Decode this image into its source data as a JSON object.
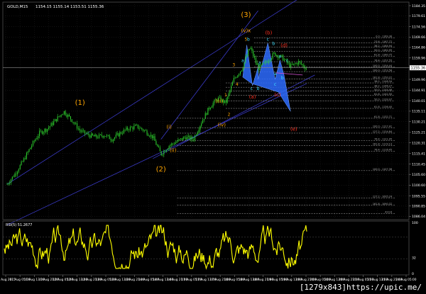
{
  "header": {
    "title": "GOLD,M15",
    "ohlc": "1154.15 1155.14 1153.51 1155.36",
    "indicator_label": "RSI(5) 51.2677"
  },
  "watermark": "[1279x843]https://upic.me/",
  "colors": {
    "background": "#000000",
    "grid": "#1c1c1c",
    "candles": "#2fd82f",
    "rsi": "#ffff00",
    "channel": "#3a3ac8",
    "abc_fill": "#2d6bff",
    "wave_orange": "#ffa500",
    "wave_red": "#ff3020",
    "fib": "#b0b0b0",
    "labels_text": "#ffffff"
  },
  "chart_data": [
    {
      "type": "candlestick",
      "title": "GOLD,M15",
      "y_axis_ticks": [
        1184.35,
        1179.61,
        1174.56,
        1169.66,
        1164.86,
        1159.96,
        1155.36,
        1149.96,
        1144.91,
        1140.01,
        1135.11,
        1130.21,
        1125.21,
        1120.31,
        1115.41,
        1110.45,
        1105.6,
        1100.6,
        1095.55,
        1090.85,
        1086.04
      ],
      "ylim": [
        1084.5,
        1186
      ],
      "x_axis_ticks": [
        "10 Aug 2015",
        "11 Aug 05:00",
        "11 Aug 13:00",
        "11 Aug 21:00",
        "12 Aug 05:00",
        "12 Aug 13:00",
        "12 Aug 21:00",
        "13 Aug 05:00",
        "13 Aug 13:00",
        "13 Aug 21:00",
        "14 Aug 05:00",
        "14 Aug 13:00",
        "14 Aug 21:00",
        "17 Aug 05:00",
        "17 Aug 13:00",
        "17 Aug 21:00",
        "18 Aug 05:00",
        "18 Aug 13:00",
        "18 Aug 21:00",
        "19 Aug 05:00",
        "19 Aug 13:00",
        "19 Aug 21:00",
        "20 Aug 05:00",
        "20 Aug 13:00",
        "20 Aug 21:00",
        "21 Aug 05:00",
        "21 Aug 13:00",
        "21 Aug 21:00",
        "24 Aug 05:00"
      ],
      "current_price": 1155.36,
      "price_path": [
        [
          0,
          1101
        ],
        [
          1,
          1106
        ],
        [
          2,
          1112
        ],
        [
          3,
          1119
        ],
        [
          4,
          1125
        ],
        [
          5,
          1127
        ],
        [
          6,
          1131
        ],
        [
          7,
          1135
        ],
        [
          8,
          1131
        ],
        [
          9,
          1126
        ],
        [
          10,
          1124
        ],
        [
          11,
          1123
        ],
        [
          12,
          1124
        ],
        [
          13,
          1122
        ],
        [
          14,
          1125
        ],
        [
          15,
          1127
        ],
        [
          16,
          1128
        ],
        [
          17,
          1126
        ],
        [
          18,
          1123
        ],
        [
          19,
          1115
        ],
        [
          20,
          1119
        ],
        [
          21,
          1121
        ],
        [
          22,
          1123
        ],
        [
          23,
          1122
        ],
        [
          24,
          1130
        ],
        [
          25,
          1137
        ],
        [
          26,
          1141
        ],
        [
          27,
          1139
        ],
        [
          28,
          1150
        ],
        [
          29,
          1155
        ],
        [
          30,
          1165
        ],
        [
          31,
          1155
        ],
        [
          32,
          1158
        ],
        [
          33,
          1162
        ],
        [
          34,
          1160
        ],
        [
          35,
          1156
        ],
        [
          36,
          1158
        ],
        [
          37,
          1155
        ]
      ],
      "wave_labels": [
        {
          "text": "(1)",
          "color": "orange",
          "x": 9,
          "y": 1138
        },
        {
          "text": "(2)",
          "color": "orange",
          "x": 19,
          "y": 1107
        },
        {
          "text": "(3)",
          "color": "orange",
          "x": 29.5,
          "y": 1179
        },
        {
          "text": "(v)x",
          "color": "orange",
          "x": 29.5,
          "y": 1172
        },
        {
          "text": "5",
          "color": "orange",
          "x": 29.5,
          "y": 1168
        },
        {
          "text": "(i)",
          "color": "orange",
          "x": 20,
          "y": 1127
        },
        {
          "text": "(ii)",
          "color": "orange",
          "x": 20.5,
          "y": 1116
        },
        {
          "text": "(iii)",
          "color": "orange",
          "x": 26.2,
          "y": 1139
        },
        {
          "text": "(iv)",
          "color": "orange",
          "x": 26.5,
          "y": 1128
        },
        {
          "text": "1",
          "color": "orange",
          "x": 27,
          "y": 1142
        },
        {
          "text": "2",
          "color": "orange",
          "x": 27.4,
          "y": 1133
        },
        {
          "text": "3",
          "color": "orange",
          "x": 28,
          "y": 1156
        },
        {
          "text": "4",
          "color": "orange",
          "x": 28.4,
          "y": 1147
        },
        {
          "text": "(b)",
          "color": "red",
          "x": 32.3,
          "y": 1171
        },
        {
          "text": "(d)",
          "color": "red",
          "x": 34.2,
          "y": 1165
        },
        {
          "text": "(a)",
          "color": "red",
          "x": 30.3,
          "y": 1141
        },
        {
          "text": "(c)",
          "color": "red",
          "x": 33.4,
          "y": 1142
        },
        {
          "text": "(e)",
          "color": "red",
          "x": 35.4,
          "y": 1126
        },
        {
          "text": "a",
          "color": "cyan",
          "x": 29.1,
          "y": 1158
        },
        {
          "text": "b",
          "color": "cyan",
          "x": 29.8,
          "y": 1168
        },
        {
          "text": "c",
          "color": "cyan",
          "x": 30.2,
          "y": 1145
        },
        {
          "text": "a",
          "color": "cyan",
          "x": 31.2,
          "y": 1157
        },
        {
          "text": "b",
          "color": "cyan",
          "x": 31.0,
          "y": 1145
        },
        {
          "text": "c",
          "color": "cyan",
          "x": 32.2,
          "y": 1168
        },
        {
          "text": "b",
          "color": "cyan",
          "x": 32.9,
          "y": 1166
        },
        {
          "text": "a",
          "color": "cyan",
          "x": 33.7,
          "y": 1160
        },
        {
          "text": "c",
          "color": "cyan",
          "x": 34.6,
          "y": 1158
        },
        {
          "text": "a",
          "color": "cyan",
          "x": 33.1,
          "y": 1152
        },
        {
          "text": "b",
          "color": "cyan",
          "x": 34.0,
          "y": 1150
        },
        {
          "text": "c",
          "color": "cyan",
          "x": 33.1,
          "y": 1147
        }
      ],
      "fib_levels": [
        {
          "label": "0.0 - 1169.36",
          "y": 1169.36
        },
        {
          "label": "23.6 - 1167.72",
          "y": 1166.9
        },
        {
          "label": "38.2 - 1164.94",
          "y": 1164.94
        },
        {
          "label": "50.0 - 1162.95",
          "y": 1162.95
        },
        {
          "label": "61.8 - 1160.75",
          "y": 1160.75
        },
        {
          "label": "76.4 - 1157.55",
          "y": 1158.2
        },
        {
          "label": "100.0 - 1154.44",
          "y": 1155.7
        },
        {
          "label": "100.0 - 1153.56",
          "y": 1153.56
        },
        {
          "label": "161.8 - 1150.22",
          "y": 1150.22
        },
        {
          "label": "38.2 - 1148.34",
          "y": 1148.3
        },
        {
          "label": "38.2 - 1146.27",
          "y": 1146.27
        },
        {
          "label": "50.0 - 1144.46",
          "y": 1144.46
        },
        {
          "label": "61.8 - 1142.50",
          "y": 1142.5
        },
        {
          "label": "50.0 - 1139.97",
          "y": 1139.97
        },
        {
          "label": "61.8 - 1136.40",
          "y": 1136.4
        },
        {
          "label": "61.8 - 1132.71",
          "y": 1131.8
        },
        {
          "label": "100.0 - 1127.41",
          "y": 1127.41
        },
        {
          "label": "127.2 - 1124.84",
          "y": 1124.84
        },
        {
          "label": "76.4 - 1121.45",
          "y": 1121.45
        },
        {
          "label": "161.8 - 1119.13",
          "y": 1119.13
        },
        {
          "label": "76.4 - 1116.45",
          "y": 1116.45
        },
        {
          "label": "100.0 - 1107.36",
          "y": 1107.36
        },
        {
          "label": "127.2 - 1095.24",
          "y": 1094.6
        },
        {
          "label": "161.8 - 1090.32",
          "y": 1091.2
        },
        {
          "label": "423.6",
          "y": 1087.3
        }
      ]
    },
    {
      "type": "line",
      "title": "RSI(5) 51.2677",
      "ylim": [
        0,
        100
      ],
      "y_axis_ticks": [
        100,
        32,
        0
      ],
      "levels": [
        70,
        30
      ]
    }
  ]
}
